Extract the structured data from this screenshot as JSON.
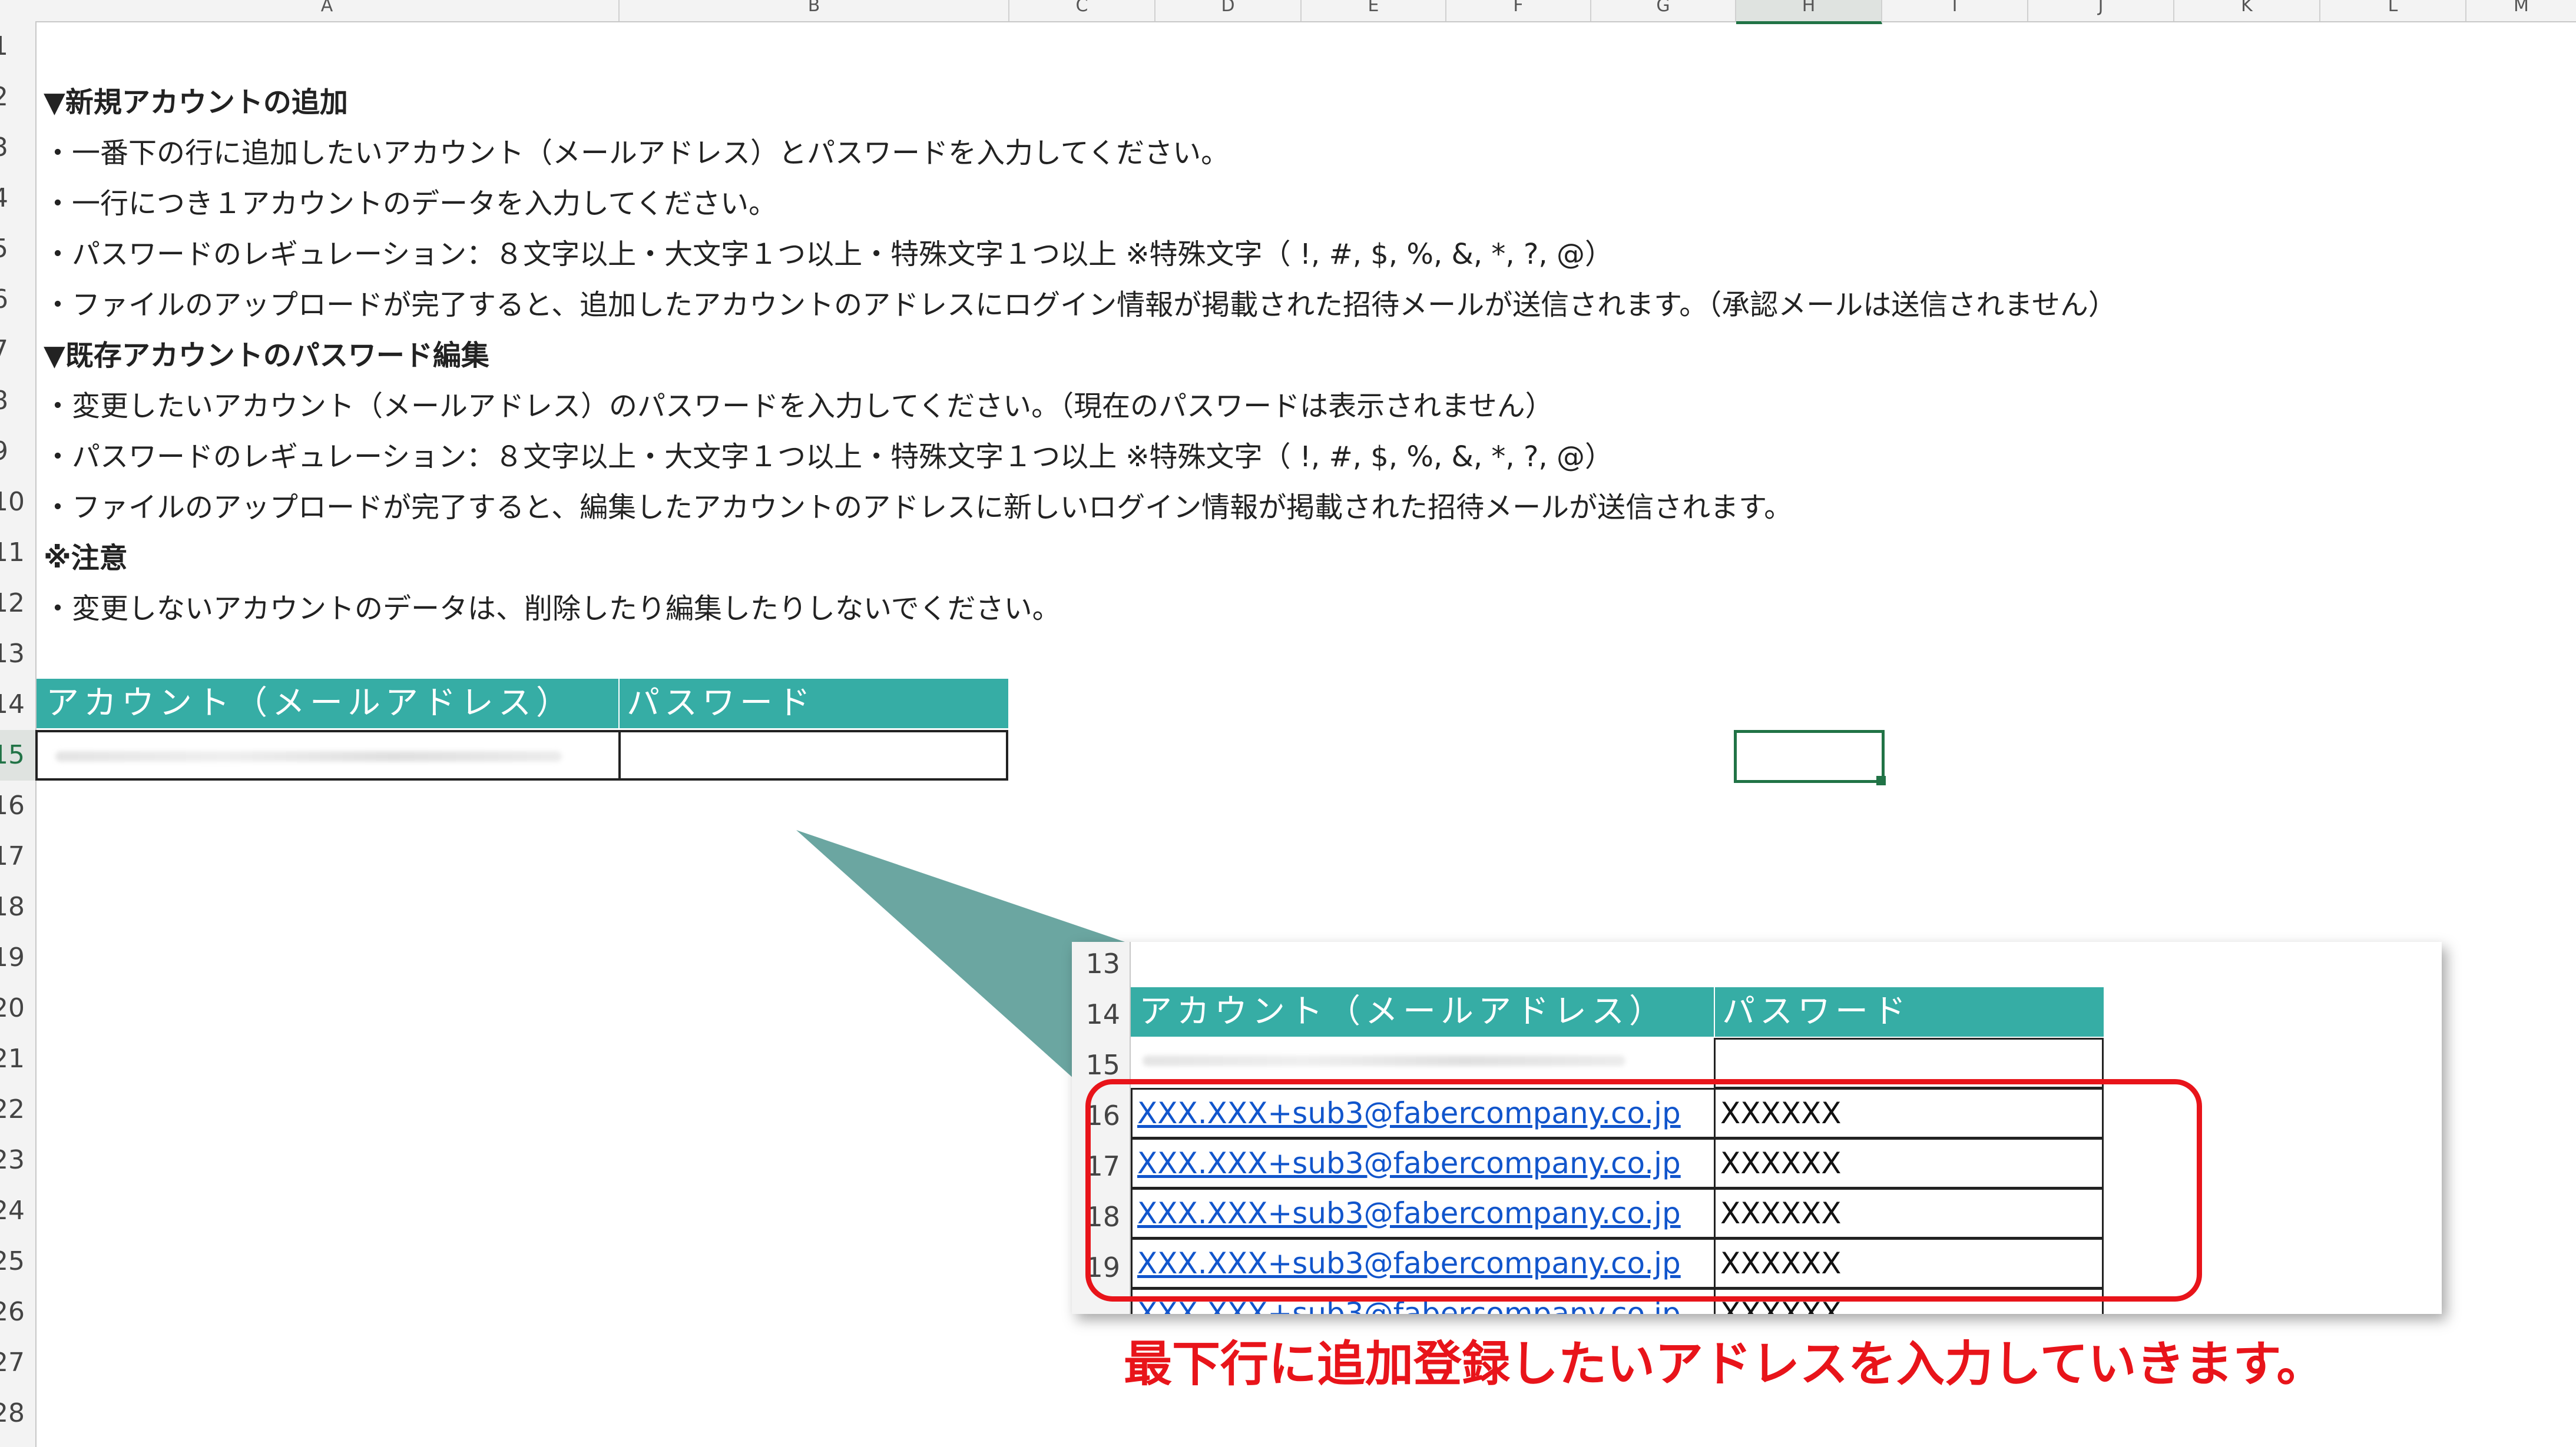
{
  "columns": [
    "A",
    "B",
    "C",
    "D",
    "E",
    "F",
    "G",
    "H",
    "I",
    "J",
    "K",
    "L",
    "M"
  ],
  "rows": [
    "1",
    "2",
    "3",
    "4",
    "5",
    "6",
    "7",
    "8",
    "9",
    "10",
    "11",
    "12",
    "13",
    "14",
    "15",
    "16",
    "17",
    "18",
    "19",
    "20",
    "21",
    "22",
    "23",
    "24",
    "25",
    "26",
    "27",
    "28"
  ],
  "instructions": [
    {
      "row": 2,
      "bold": true,
      "text": "▼新規アカウントの追加"
    },
    {
      "row": 3,
      "bold": false,
      "text": "・一番下の行に追加したいアカウント（メールアドレス）とパスワードを入力してください。"
    },
    {
      "row": 4,
      "bold": false,
      "text": "・一行につき１アカウントのデータを入力してください。"
    },
    {
      "row": 5,
      "bold": false,
      "text": "・パスワードのレギュレーション：８文字以上・大文字１つ以上・特殊文字１つ以上 ※特殊文字（ !, #, $, %, &, *, ?, @）"
    },
    {
      "row": 6,
      "bold": false,
      "text": "・ファイルのアップロードが完了すると、追加したアカウントのアドレスにログイン情報が掲載された招待メールが送信されます。（承認メールは送信されません）"
    },
    {
      "row": 7,
      "bold": true,
      "text": "▼既存アカウントのパスワード編集"
    },
    {
      "row": 8,
      "bold": false,
      "text": "・変更したいアカウント（メールアドレス）のパスワードを入力してください。（現在のパスワードは表示されません）"
    },
    {
      "row": 9,
      "bold": false,
      "text": "・パスワードのレギュレーション：８文字以上・大文字１つ以上・特殊文字１つ以上 ※特殊文字（ !, #, $, %, &, *, ?, @）"
    },
    {
      "row": 10,
      "bold": false,
      "text": "・ファイルのアップロードが完了すると、編集したアカウントのアドレスに新しいログイン情報が掲載された招待メールが送信されます。"
    },
    {
      "row": 11,
      "bold": true,
      "text": "※注意"
    },
    {
      "row": 12,
      "bold": false,
      "text": "・変更しないアカウントのデータは、削除したり編集したりしないでください。"
    }
  ],
  "table": {
    "header_account": "アカウント（メールアドレス）",
    "header_password": "パスワード"
  },
  "inset": {
    "rows": [
      "13",
      "14",
      "15",
      "16",
      "17",
      "18",
      "19"
    ],
    "entries": [
      {
        "row": "16",
        "email": "XXX.XXX+sub3@fabercompany.co.jp",
        "password": "XXXXXX"
      },
      {
        "row": "17",
        "email": "XXX.XXX+sub3@fabercompany.co.jp",
        "password": "XXXXXX"
      },
      {
        "row": "18",
        "email": "XXX.XXX+sub3@fabercompany.co.jp",
        "password": "XXXXXX"
      },
      {
        "row": "19",
        "email": "XXX.XXX+sub3@fabercompany.co.jp",
        "password": "XXXXXX"
      }
    ]
  },
  "caption": "最下行に追加登録したいアドレスを入力していきます。",
  "colors": {
    "table_header": "#36ada5",
    "callout": "#5e9e99",
    "highlight_red": "#e8141a",
    "link": "#1155cc",
    "selection": "#217346"
  }
}
